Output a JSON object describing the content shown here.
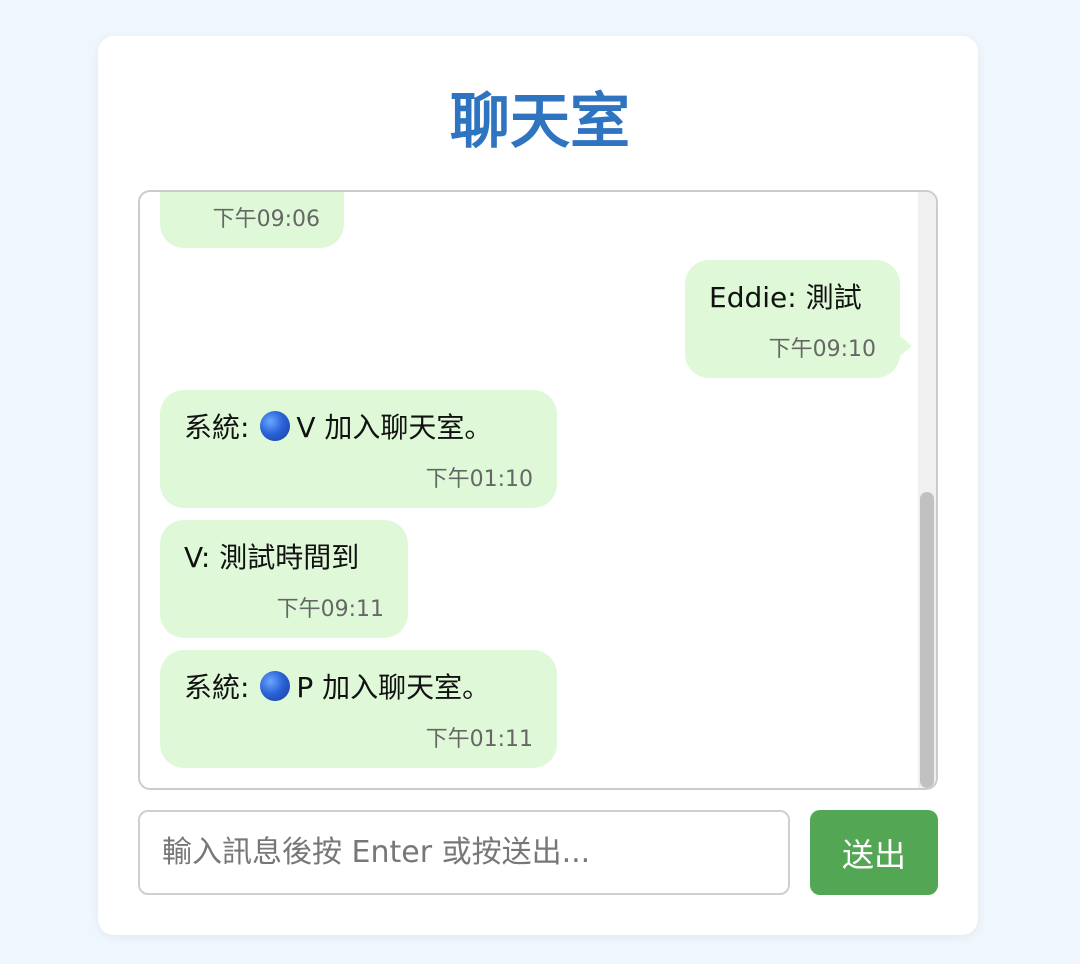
{
  "header": {
    "title": "聊天室"
  },
  "messages": [
    {
      "text": "",
      "time": "下午09:06",
      "side": "left",
      "partial": true
    },
    {
      "text": "Eddie: 測試",
      "time": "下午09:10",
      "side": "right"
    },
    {
      "prefix": "系統:",
      "icon": "blue-circle-icon",
      "suffix": "V 加入聊天室。",
      "time": "下午01:10",
      "side": "left"
    },
    {
      "text": "V: 測試時間到",
      "time": "下午09:11",
      "side": "left"
    },
    {
      "prefix": "系統:",
      "icon": "blue-circle-icon",
      "suffix": "P 加入聊天室。",
      "time": "下午01:11",
      "side": "left"
    }
  ],
  "composer": {
    "placeholder": "輸入訊息後按 Enter 或按送出...",
    "value": "",
    "send_label": "送出"
  },
  "colors": {
    "page_bg": "#f0f6fd",
    "title": "#2f74c0",
    "bubble": "#dff9d8",
    "send_button": "#53a653"
  }
}
